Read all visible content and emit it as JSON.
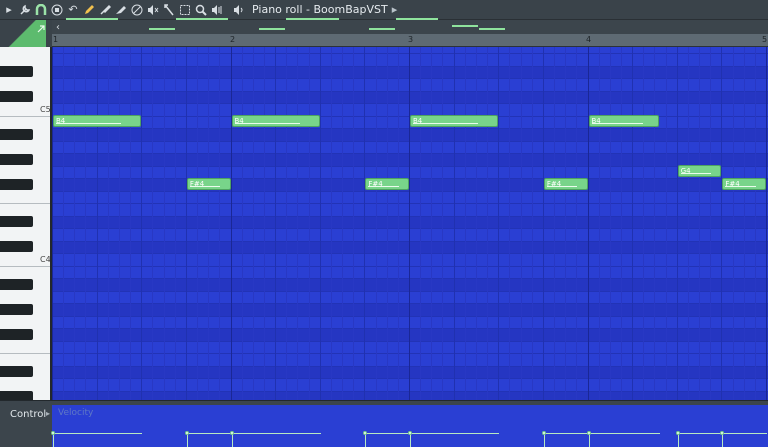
{
  "window": {
    "title": "Piano roll - BoomBapVST",
    "title_arrow": "▸"
  },
  "toolbar": {
    "icons": [
      "menu-arrow-icon",
      "wrench-icon",
      "magnet-icon",
      "stop-icon",
      "undo-icon",
      "pencil-icon",
      "paint-brush-icon",
      "delete-tool-icon",
      "mute-tool-icon",
      "slice-icon",
      "select-icon",
      "zoom-icon",
      "playback-icon",
      "speaker-icon"
    ]
  },
  "ruler": {
    "bars": [
      "1",
      "2",
      "3",
      "4",
      "5"
    ]
  },
  "keyboard": {
    "labels": [
      "C5",
      "C4"
    ]
  },
  "notes": [
    {
      "label": "B4",
      "pitch": "B4",
      "start": 1.0,
      "length": 0.5
    },
    {
      "label": "F#4",
      "pitch": "F#4",
      "start": 1.75,
      "length": 0.25
    },
    {
      "label": "B4",
      "pitch": "B4",
      "start": 2.0,
      "length": 0.5
    },
    {
      "label": "F#4",
      "pitch": "F#4",
      "start": 2.75,
      "length": 0.25
    },
    {
      "label": "B4",
      "pitch": "B4",
      "start": 3.0,
      "length": 0.5
    },
    {
      "label": "F#4",
      "pitch": "F#4",
      "start": 3.75,
      "length": 0.25
    },
    {
      "label": "B4",
      "pitch": "B4",
      "start": 4.0,
      "length": 0.4
    },
    {
      "label": "G4",
      "pitch": "G4",
      "start": 4.5,
      "length": 0.25
    },
    {
      "label": "F#4",
      "pitch": "F#4",
      "start": 4.75,
      "length": 0.25
    }
  ],
  "control": {
    "label": "Control",
    "arrow": "▸",
    "target": "Velocity"
  },
  "colors": {
    "grid_bg": "#2a3fd3",
    "note_fill": "#78d48a",
    "toolbar_bg": "#3a434a",
    "accent_green": "#59b06a"
  }
}
